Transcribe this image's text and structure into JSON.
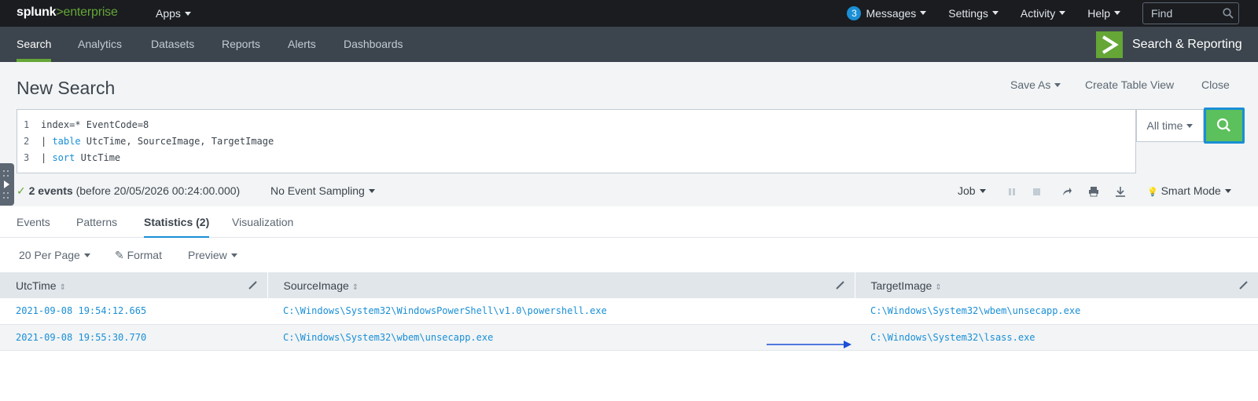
{
  "topbar": {
    "logo_splunk": "splunk",
    "logo_gt": ">",
    "logo_enterprise": "enterprise",
    "apps_label": "Apps",
    "messages_count": "3",
    "messages_label": "Messages",
    "settings_label": "Settings",
    "activity_label": "Activity",
    "help_label": "Help",
    "find_placeholder": "Find"
  },
  "navbar": {
    "items": [
      "Search",
      "Analytics",
      "Datasets",
      "Reports",
      "Alerts",
      "Dashboards"
    ],
    "active_index": 0,
    "app_title": "Search & Reporting",
    "accent_color": "#65a637"
  },
  "search": {
    "title": "New Search",
    "save_as": "Save As",
    "create_table_view": "Create Table View",
    "close": "Close",
    "query_lines": [
      {
        "num": "1",
        "text": "index=* EventCode=8"
      },
      {
        "num": "2",
        "pipe": "| ",
        "command": "table",
        "args": " UtcTime, SourceImage, TargetImage"
      },
      {
        "num": "3",
        "pipe": "| ",
        "command": "sort",
        "args": " UtcTime"
      }
    ],
    "time_range": "All time"
  },
  "status": {
    "events_count": "2 events",
    "events_detail": "(before 20/05/2026 00:24:00.000)",
    "sampling": "No Event Sampling",
    "job": "Job",
    "mode": "Smart Mode"
  },
  "tabs": [
    "Events",
    "Patterns",
    "Statistics (2)",
    "Visualization"
  ],
  "active_tab": 2,
  "toolbar": {
    "per_page": "20 Per Page",
    "format": "Format",
    "preview": "Preview"
  },
  "table": {
    "columns": [
      "UtcTime",
      "SourceImage",
      "TargetImage"
    ],
    "rows": [
      [
        "2021-09-08 19:54:12.665",
        "C:\\Windows\\System32\\WindowsPowerShell\\v1.0\\powershell.exe",
        "C:\\Windows\\System32\\wbem\\unsecapp.exe"
      ],
      [
        "2021-09-08 19:55:30.770",
        "C:\\Windows\\System32\\wbem\\unsecapp.exe",
        "C:\\Windows\\System32\\lsass.exe"
      ]
    ]
  }
}
